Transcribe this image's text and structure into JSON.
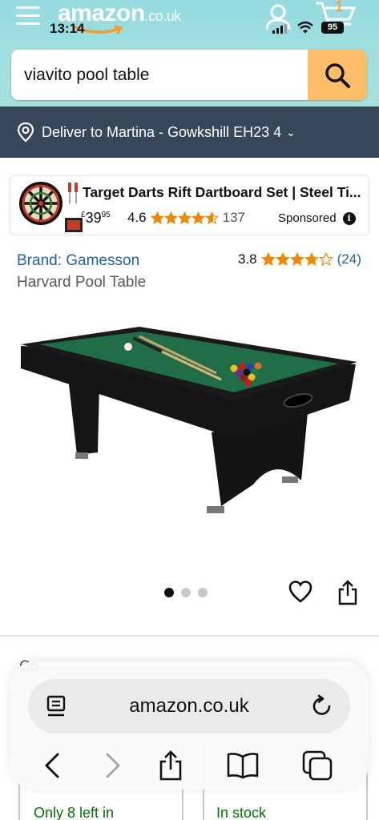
{
  "status_bar": {
    "time": "13:14",
    "battery": "95"
  },
  "header": {
    "logo_main": "amazon",
    "logo_tld": ".co.uk",
    "cart_count": "1"
  },
  "search": {
    "value": "viavito pool table"
  },
  "delivery": {
    "label": "Deliver to Martina - Gowkshill EH23 4"
  },
  "sponsored_ad": {
    "title": "Target Darts Rift Dartboard Set | Steel Ti...",
    "price_currency": "£",
    "price_whole": "39",
    "price_fraction": "95",
    "rating": "4.6",
    "stars": 4.6,
    "review_count": "137",
    "sponsored_label": "Sponsored"
  },
  "product": {
    "brand": "Brand: Gamesson",
    "title": "Harvard Pool Table",
    "rating": "3.8",
    "stars": 3.8,
    "review_count": "(24)",
    "image_count": 3,
    "active_image": 1
  },
  "below_fold": {
    "partial_heading": "Co",
    "stock_left": "Only 8 left in",
    "stock_right": "In stock"
  },
  "browser": {
    "url": "amazon.co.uk"
  },
  "colors": {
    "search_button": "#febd69",
    "delivery_bar": "#37475a",
    "link": "#2162a1",
    "star": "#f08804"
  }
}
